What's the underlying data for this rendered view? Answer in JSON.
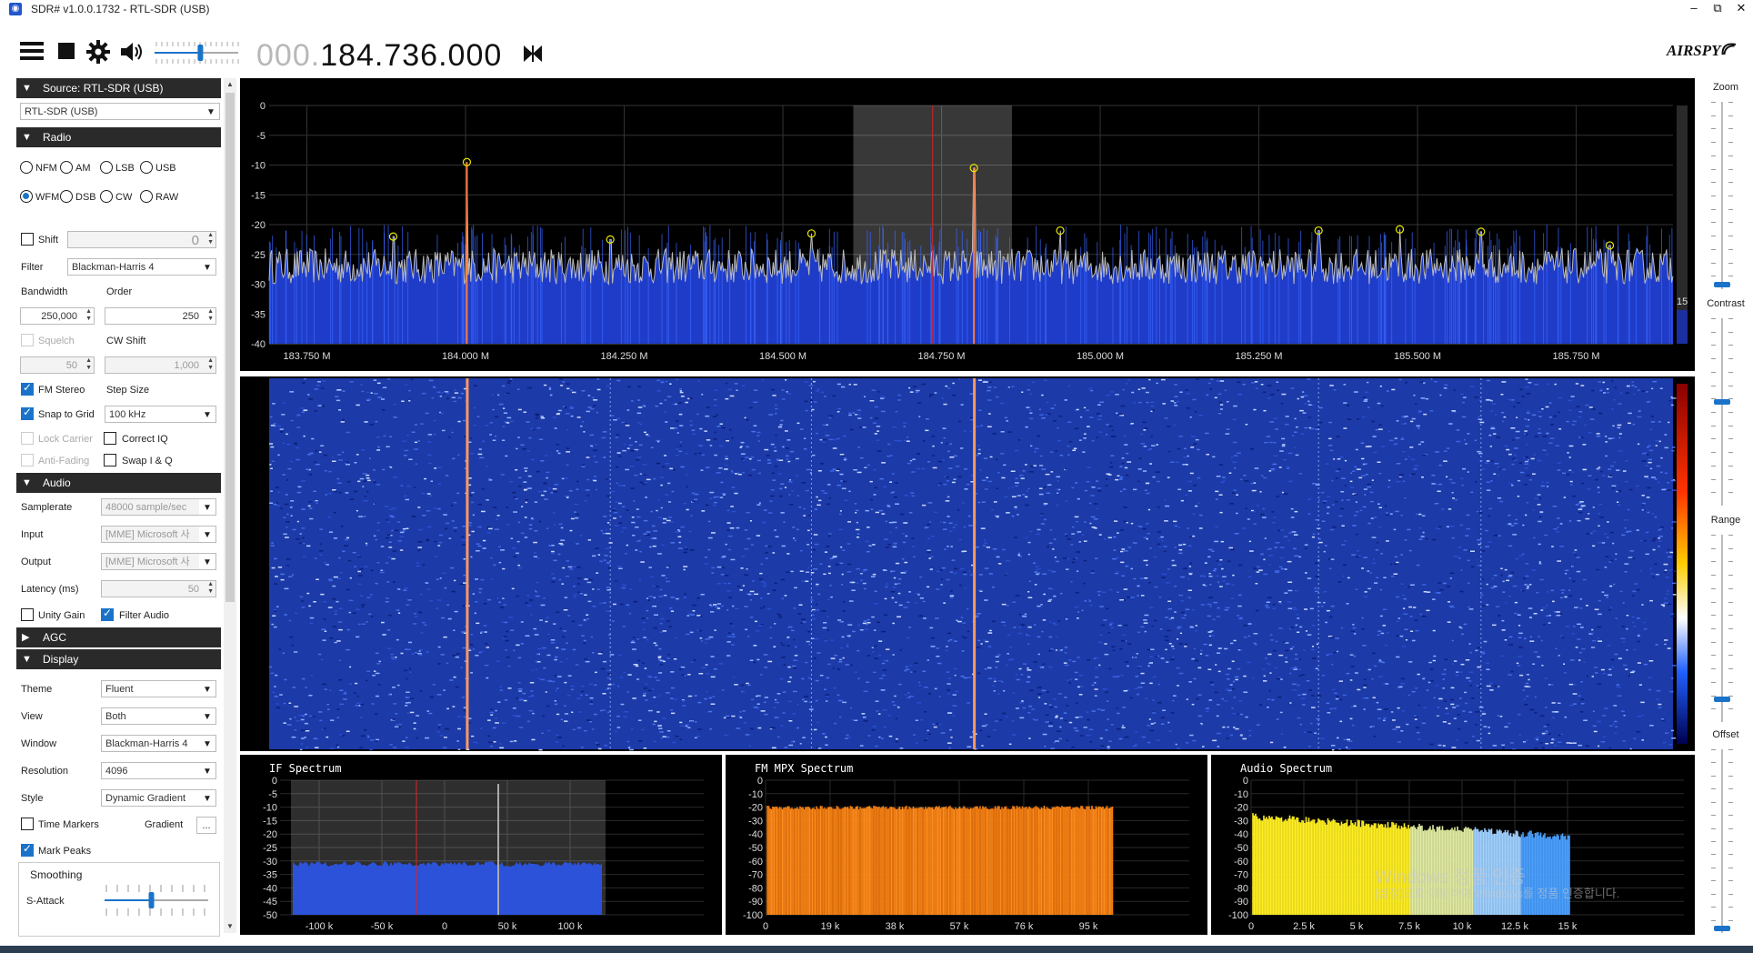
{
  "window": {
    "title": "SDR# v1.0.0.1732 - RTL-SDR (USB)",
    "min_label": "–",
    "restore_label": "⧉",
    "close_label": "✕"
  },
  "toolbar": {
    "menu_icon": "hamburger-icon",
    "stop_icon": "stop-icon",
    "settings_icon": "gear-icon",
    "audio_icon": "speaker-icon",
    "volume": 0.55,
    "frequency_dim": "000.",
    "frequency": "184.736.000",
    "tuning_mode_icon": "bowtie-icon",
    "brand": "AIRSPY"
  },
  "source": {
    "header": "Source: RTL-SDR (USB)",
    "device": "RTL-SDR (USB)"
  },
  "radio": {
    "header": "Radio",
    "modes_row1": [
      "NFM",
      "AM",
      "LSB",
      "USB"
    ],
    "modes_row2": [
      "WFM",
      "DSB",
      "CW",
      "RAW"
    ],
    "selected_mode": "WFM",
    "shift_label": "Shift",
    "shift_value": "0",
    "filter_label": "Filter",
    "filter_value": "Blackman-Harris 4",
    "bandwidth_label": "Bandwidth",
    "order_label": "Order",
    "bandwidth_value": "250,000",
    "order_value": "250",
    "squelch_label": "Squelch",
    "cwshift_label": "CW Shift",
    "squelch_value": "50",
    "cwshift_value": "1,000",
    "fm_stereo_label": "FM Stereo",
    "step_size_label": "Step Size",
    "snap_label": "Snap to Grid",
    "step_value": "100 kHz",
    "lock_carrier_label": "Lock Carrier",
    "correct_iq_label": "Correct IQ",
    "anti_fading_label": "Anti-Fading",
    "swap_iq_label": "Swap I & Q"
  },
  "audio": {
    "header": "Audio",
    "samplerate_label": "Samplerate",
    "samplerate_value": "48000 sample/sec",
    "input_label": "Input",
    "input_value": "[MME] Microsoft 사",
    "output_label": "Output",
    "output_value": "[MME] Microsoft 사",
    "latency_label": "Latency (ms)",
    "latency_value": "50",
    "unity_gain_label": "Unity Gain",
    "filter_audio_label": "Filter Audio"
  },
  "agc": {
    "header": "AGC"
  },
  "display": {
    "header": "Display",
    "theme_label": "Theme",
    "theme_value": "Fluent",
    "view_label": "View",
    "view_value": "Both",
    "window_label": "Window",
    "window_value": "Blackman-Harris 4",
    "resolution_label": "Resolution",
    "resolution_value": "4096",
    "style_label": "Style",
    "style_value": "Dynamic Gradient",
    "time_markers_label": "Time Markers",
    "gradient_label": "Gradient",
    "gradient_btn": "...",
    "mark_peaks_label": "Mark Peaks",
    "smoothing_label": "Smoothing",
    "sattack_label": "S-Attack",
    "sattack_value": 0.45
  },
  "right": {
    "zoom_label": "Zoom",
    "contrast_label": "Contrast",
    "range_label": "Range",
    "offset_label": "Offset",
    "zoom_value": 0.0,
    "contrast_value": 0.55,
    "range_value": 0.1,
    "offset_value": 0.0
  },
  "spectrum": {
    "y_ticks": [
      "0",
      "-5",
      "-10",
      "-15",
      "-20",
      "-25",
      "-30",
      "-35",
      "-40"
    ],
    "x_ticks": [
      "183.750 M",
      "184.000 M",
      "184.250 M",
      "184.500 M",
      "184.750 M",
      "185.000 M",
      "185.250 M",
      "185.500 M",
      "185.750 M"
    ],
    "side_value": "15",
    "noise_floor_db": -25,
    "peaks": [
      {
        "freq": 183.886,
        "db": -22
      },
      {
        "freq": 184.002,
        "db": -9.5
      },
      {
        "freq": 184.228,
        "db": -22.5
      },
      {
        "freq": 184.545,
        "db": -21.5
      },
      {
        "freq": 184.801,
        "db": -10.5
      },
      {
        "freq": 184.937,
        "db": -21
      },
      {
        "freq": 185.344,
        "db": -21
      },
      {
        "freq": 185.472,
        "db": -20.8
      },
      {
        "freq": 185.6,
        "db": -21.2
      },
      {
        "freq": 185.803,
        "db": -23.5
      }
    ],
    "tuned_freq": 184.736,
    "bandwidth_mhz": 0.25,
    "colors": {
      "fill": "#1f3cc8",
      "trace": "#bbbbbb",
      "marker": "#e8e800",
      "cursor": "#dd2222"
    }
  },
  "if_spectrum": {
    "title": "IF Spectrum",
    "y_ticks": [
      "0",
      "-5",
      "-10",
      "-15",
      "-20",
      "-25",
      "-30",
      "-35",
      "-40",
      "-45",
      "-50"
    ],
    "x_ticks": [
      "-100 k",
      "-50 k",
      "0",
      "50 k",
      "100 k"
    ]
  },
  "mpx_spectrum": {
    "title": "FM MPX Spectrum",
    "y_ticks": [
      "0",
      "-10",
      "-20",
      "-30",
      "-40",
      "-50",
      "-60",
      "-70",
      "-80",
      "-90",
      "-100"
    ],
    "x_ticks": [
      "0",
      "19 k",
      "38 k",
      "57 k",
      "76 k",
      "95 k"
    ]
  },
  "audio_spectrum": {
    "title": "Audio Spectrum",
    "y_ticks": [
      "0",
      "-10",
      "-20",
      "-30",
      "-40",
      "-50",
      "-60",
      "-70",
      "-80",
      "-90",
      "-100"
    ],
    "x_ticks": [
      "0",
      "2.5 k",
      "5 k",
      "7.5 k",
      "10 k",
      "12.5 k",
      "15 k"
    ]
  },
  "watermark": {
    "line1": "Windows 정품 인증",
    "line2": "[설정]으로 이동하여 Windows를 정품 인증합니다."
  }
}
